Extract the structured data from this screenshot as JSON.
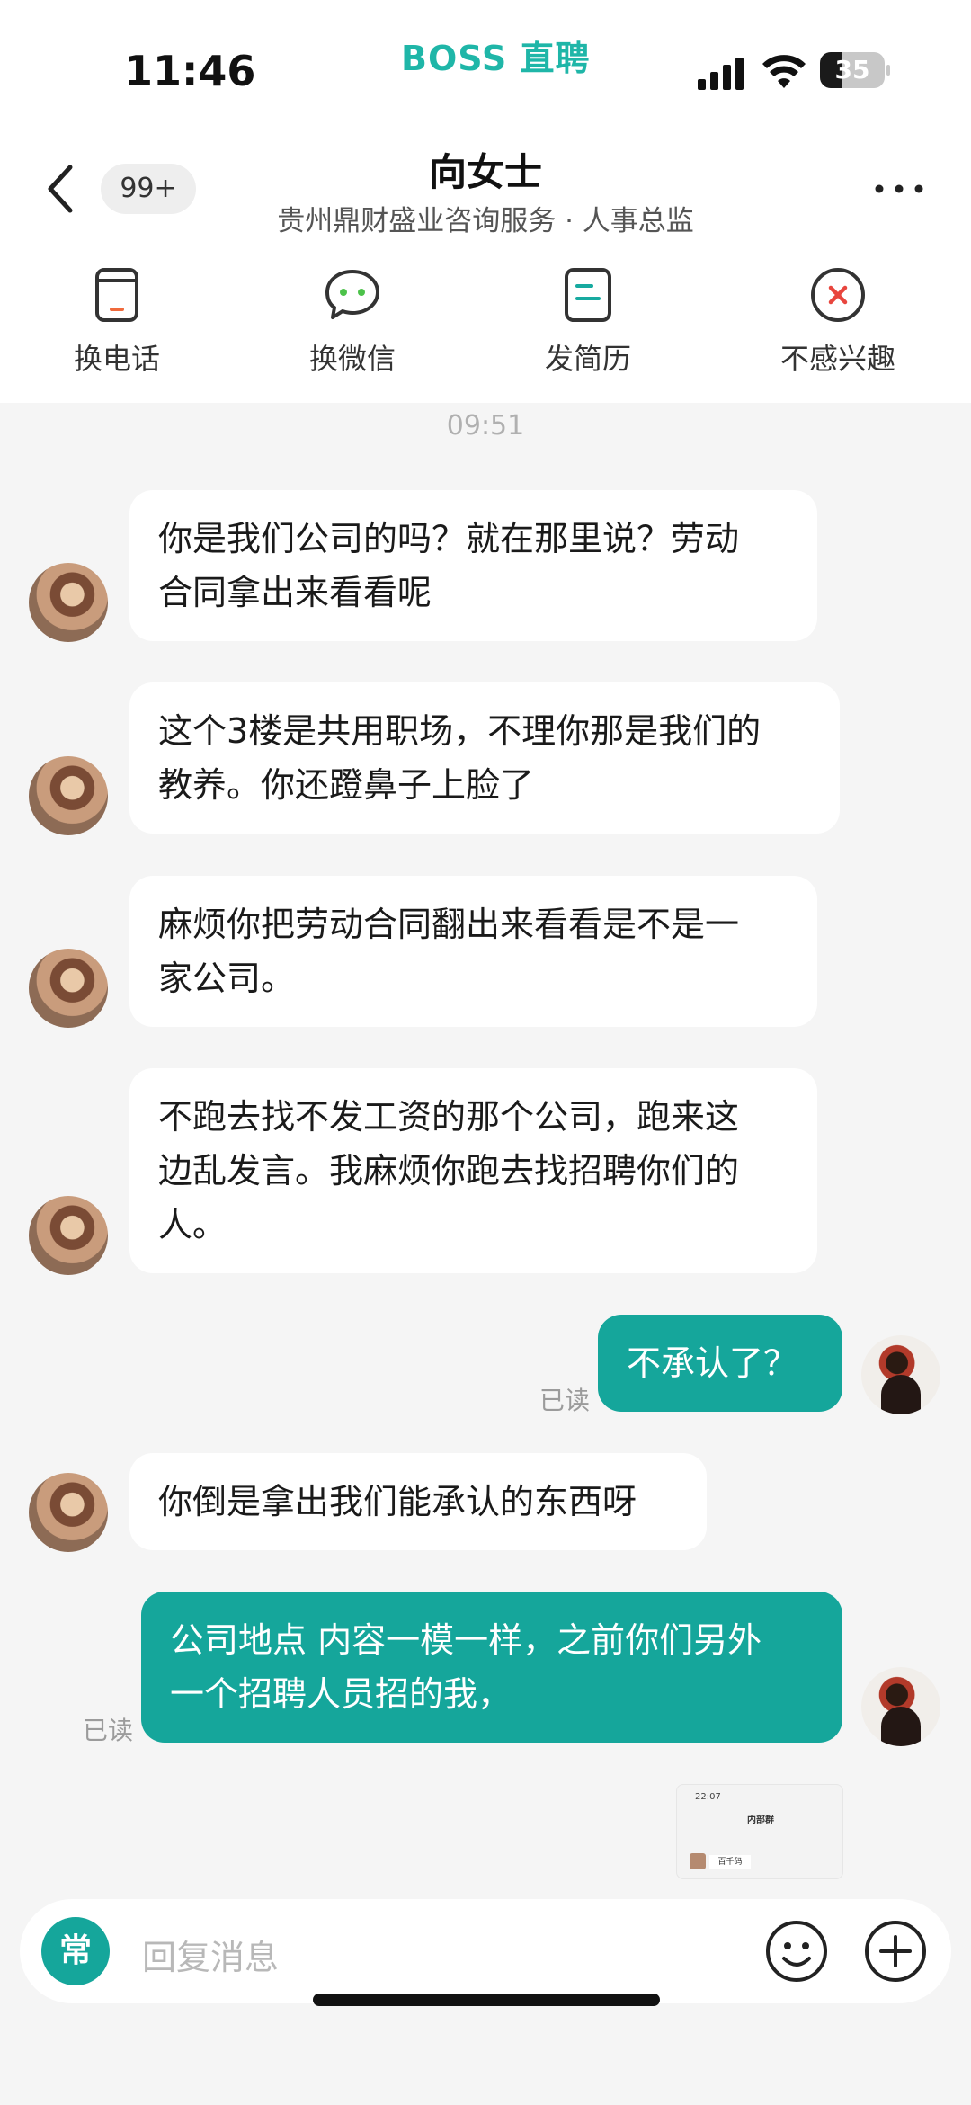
{
  "status_bar": {
    "time": "11:46",
    "brand": "BOSS 直聘",
    "battery": "35",
    "battery_level_percent": 35
  },
  "header": {
    "back_badge": "99+",
    "contact_name": "向女士",
    "contact_subtitle": "贵州鼎财盛业咨询服务 · 人事总监"
  },
  "actions": [
    {
      "label": "换电话",
      "icon": "phone-card-icon"
    },
    {
      "label": "换微信",
      "icon": "wechat-icon"
    },
    {
      "label": "发简历",
      "icon": "resume-icon"
    },
    {
      "label": "不感兴趣",
      "icon": "not-interested-icon"
    }
  ],
  "chat": {
    "timestamp": "09:51",
    "read_label": "已读",
    "messages": [
      {
        "from": "them",
        "text_lines": [
          "你是我们公司的吗？就在那里说？劳动",
          "合同拿出来看看呢"
        ]
      },
      {
        "from": "them",
        "text_lines": [
          "这个3楼是共用职场，不理你那是我们的",
          "教养。你还蹬鼻子上脸了"
        ]
      },
      {
        "from": "them",
        "text_lines": [
          "麻烦你把劳动合同翻出来看看是不是一",
          "家公司。"
        ]
      },
      {
        "from": "them",
        "text_lines": [
          "不跑去找不发工资的那个公司，跑来这",
          "边乱发言。我麻烦你跑去找招聘你们的",
          "人。"
        ]
      },
      {
        "from": "me",
        "text_lines": [
          "不承认了？"
        ],
        "read": "已读"
      },
      {
        "from": "them",
        "text_lines": [
          "你倒是拿出我们能承认的东西呀"
        ]
      },
      {
        "from": "me",
        "text_lines": [
          "公司地点 内容一模一样，之前你们另外",
          "一个招聘人员招的我，"
        ],
        "read": "已读"
      }
    ],
    "image_thumbnail": {
      "time": "22:07",
      "title": "内部群",
      "message": "百千码"
    }
  },
  "input": {
    "common_phrases_label": "常",
    "placeholder": "回复消息"
  }
}
